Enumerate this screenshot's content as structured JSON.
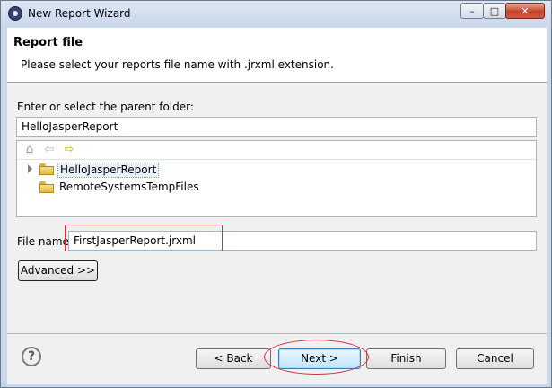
{
  "window": {
    "title": "New Report Wizard",
    "controls": {
      "minimize": "–",
      "maximize": "□",
      "close": "✕"
    }
  },
  "banner": {
    "title": "Report file",
    "description": "Please select your reports file name with .jrxml extension."
  },
  "folder_picker": {
    "label": "Enter or select the parent folder:",
    "value": "HelloJasperReport",
    "toolbar_icons": [
      "home-icon",
      "back-arrow-icon",
      "forward-arrow-icon"
    ],
    "tree_items": [
      {
        "label": "HelloJasperReport",
        "selected": true,
        "expandable": true
      },
      {
        "label": "RemoteSystemsTempFiles",
        "selected": false,
        "expandable": false
      }
    ]
  },
  "file_name": {
    "label": "File name:",
    "value": "FirstJasperReport.jrxml"
  },
  "advanced_button": "Advanced >>",
  "footer": {
    "help": "?",
    "back": "< Back",
    "next": "Next >",
    "finish": "Finish",
    "cancel": "Cancel"
  },
  "colors": {
    "annotation": "#d62f3a",
    "banner_bg": "#ffffff",
    "dialog_bg": "#f0f0f0"
  }
}
